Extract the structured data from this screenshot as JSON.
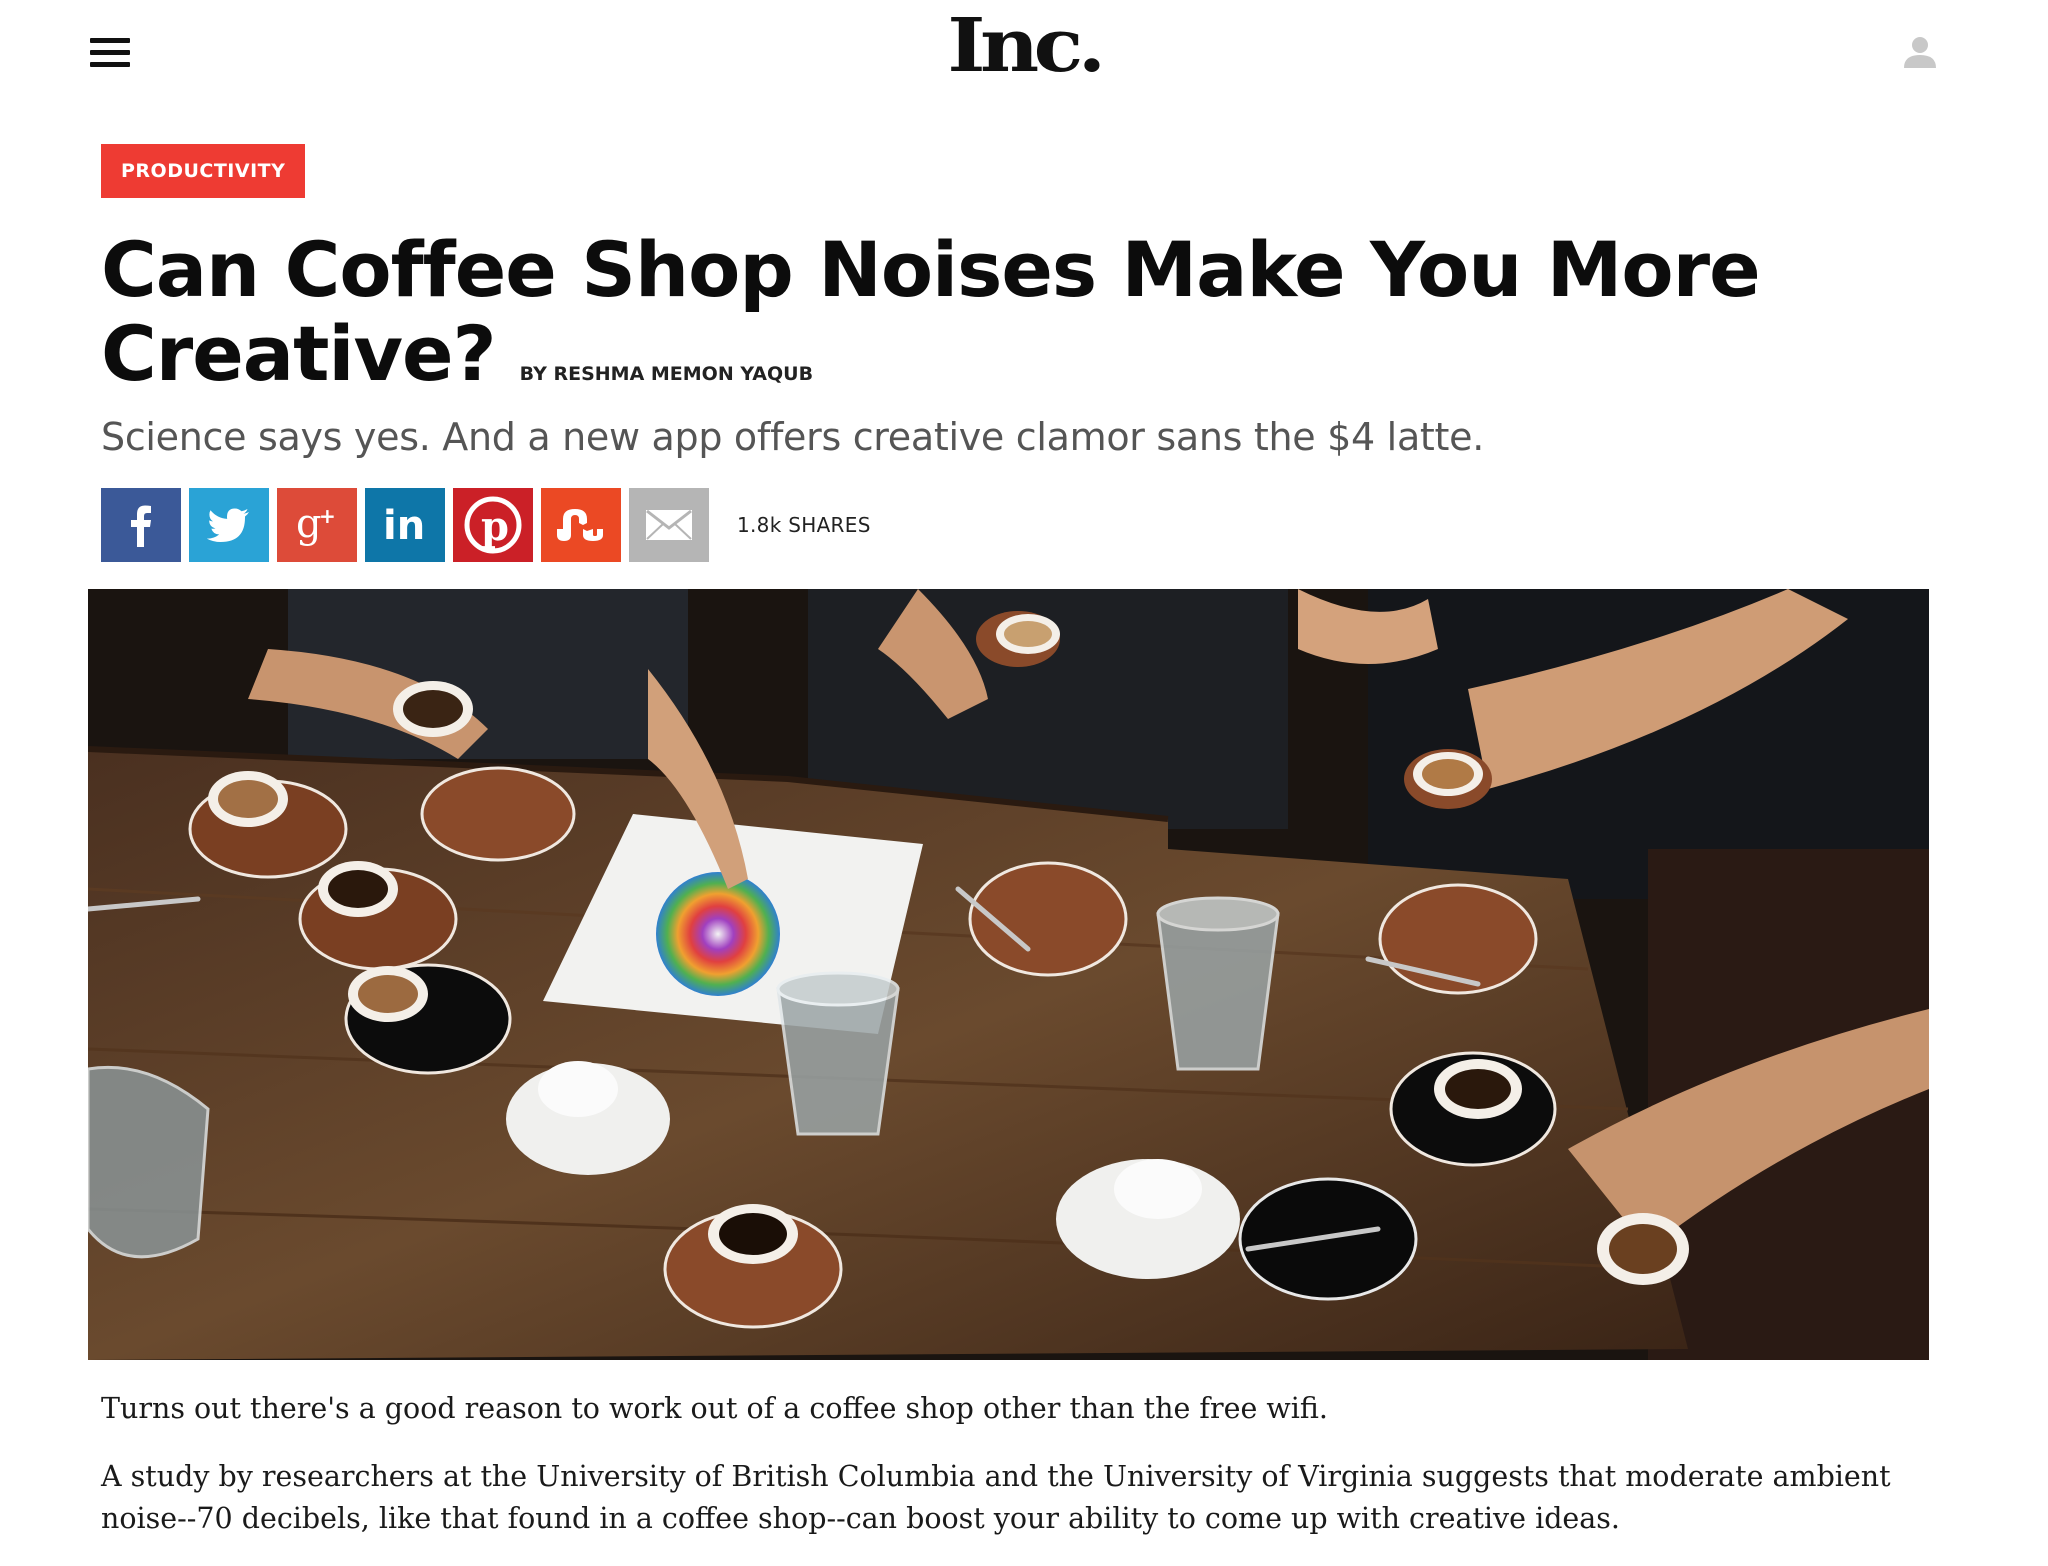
{
  "header": {
    "logo": "Inc.",
    "menu_icon": "hamburger-menu-icon",
    "user_icon": "user-account-icon"
  },
  "article": {
    "category": "PRODUCTIVITY",
    "headline": "Can Coffee Shop Noises Make You More Creative?",
    "byline_prefix": "BY",
    "author": "RESHMA MEMON YAQUB",
    "subhead": "Science says yes. And a new app offers creative clamor sans the $4 latte.",
    "share_count": "1.8k SHARES",
    "share_buttons": [
      {
        "network": "facebook",
        "icon": "facebook-icon",
        "color": "#3b5998"
      },
      {
        "network": "twitter",
        "icon": "twitter-icon",
        "color": "#2aa3d6"
      },
      {
        "network": "google-plus",
        "icon": "google-plus-icon",
        "color": "#dd4b39"
      },
      {
        "network": "linkedin",
        "icon": "linkedin-icon",
        "color": "#0e76a8"
      },
      {
        "network": "pinterest",
        "icon": "pinterest-icon",
        "color": "#cb2027"
      },
      {
        "network": "stumbleupon",
        "icon": "stumbleupon-icon",
        "color": "#eb4924"
      },
      {
        "network": "email",
        "icon": "email-icon",
        "color": "#b5b5b5"
      }
    ],
    "paragraphs": [
      "Turns out there's a good reason to work out of a coffee shop other than the free wifi.",
      "A study by researchers at the University of British Columbia and the University of Virginia suggests that moderate ambient noise--70 decibels, like that found in a coffee shop--can boost your ability to come up with creative ideas."
    ]
  },
  "colors": {
    "category_badge": "#ee3b33",
    "headline": "#0c0c0c",
    "subhead": "#555555"
  }
}
